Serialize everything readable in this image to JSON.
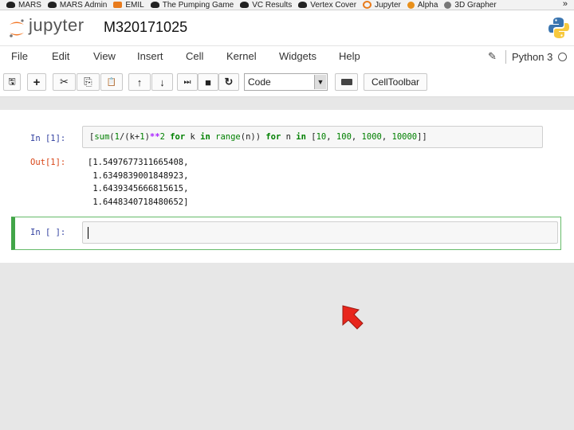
{
  "bookmarks": [
    {
      "label": "MARS",
      "icon": "mask-icon"
    },
    {
      "label": "MARS Admin",
      "icon": "mask-icon"
    },
    {
      "label": "EMIL",
      "icon": "m-icon"
    },
    {
      "label": "The Pumping Game",
      "icon": "mask-icon"
    },
    {
      "label": "VC Results",
      "icon": "mask-icon"
    },
    {
      "label": "Vertex Cover",
      "icon": "mask-icon"
    },
    {
      "label": "Jupyter",
      "icon": "jupyter-icon"
    },
    {
      "label": "Alpha",
      "icon": "gear-icon"
    },
    {
      "label": "3D Grapher",
      "icon": "globe-icon"
    }
  ],
  "bookmarks_more": "»",
  "header": {
    "logo_text": "jupyter",
    "notebook_title": "M320171025"
  },
  "menu": [
    "File",
    "Edit",
    "View",
    "Insert",
    "Cell",
    "Kernel",
    "Widgets",
    "Help"
  ],
  "kernel": {
    "name": "Python 3"
  },
  "toolbar": {
    "buttons": [
      {
        "name": "save-icon",
        "glyph": "🖫"
      },
      {
        "name": "insert-cell-icon",
        "glyph": "+"
      },
      {
        "name": "cut-icon",
        "glyph": "✂"
      },
      {
        "name": "copy-icon",
        "glyph": "⎘"
      },
      {
        "name": "paste-icon",
        "glyph": "📋"
      },
      {
        "name": "move-up-icon",
        "glyph": "↑"
      },
      {
        "name": "move-down-icon",
        "glyph": "↓"
      },
      {
        "name": "run-icon",
        "glyph": "⏭"
      },
      {
        "name": "stop-icon",
        "glyph": "■"
      },
      {
        "name": "restart-icon",
        "glyph": "↻"
      }
    ],
    "cell_type": "Code",
    "celltoolbar_label": "CellToolbar"
  },
  "cells": [
    {
      "in_prompt": "In [1]:",
      "code": "[sum(1/(k+1)**2 for k in range(n)) for n in [10, 100, 1000, 10000]]",
      "out_prompt": "Out[1]:",
      "output": "[1.5497677311665408,\n 1.6349839001848923,\n 1.6439345666815615,\n 1.6448340718480652]"
    },
    {
      "in_prompt": "In [ ]:",
      "code": ""
    }
  ]
}
